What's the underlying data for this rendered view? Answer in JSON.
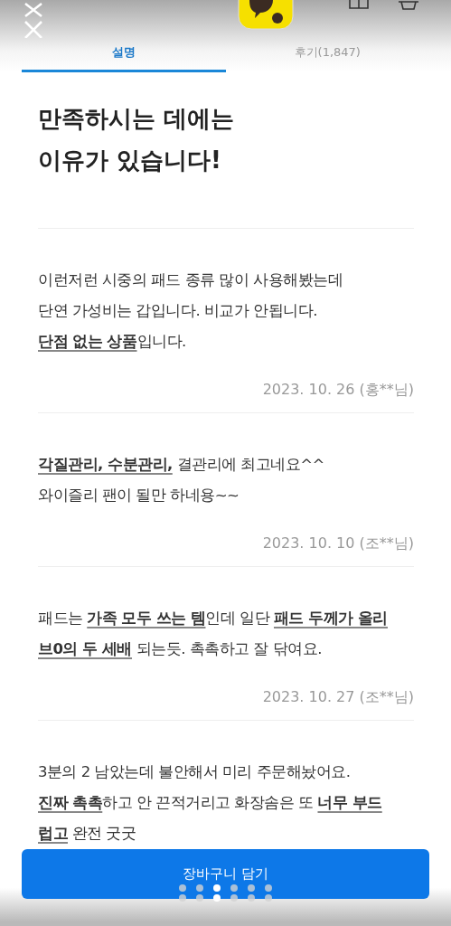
{
  "tabs": [
    {
      "label": "설명",
      "selected": true
    },
    {
      "label": "후기(1,847)",
      "selected": false
    }
  ],
  "heading": "만족하시는 데에는\n이유가 있습니다!",
  "reviews": [
    {
      "text": "이런저런 시중의 패드 종류 많이 사용해봤는데\n단연 가성비는 갑입니다. 비교가 안됩니다.\n**단점 없는 상품**입니다.",
      "date": "2023. 10. 26 (홍**님)"
    },
    {
      "text": "**각질관리, 수분관리,** 결관리에 최고네요^^\n와이즐리 팬이 될만 하네용~~",
      "date": "2023. 10. 10 (조**님)"
    },
    {
      "text": "패드는 **가족 모두 쓰는 템**인데 일단 **패드 두께가 올리\n브0의 두 세배** 되는듯. 촉촉하고 잘 닦여요.",
      "date": "2023. 10. 27 (조**님)"
    },
    {
      "text": "3분의 2 남았는데 불안해서 미리 주문해놨어요.\n**진짜 촉촉**하고 안 끈적거리고 화장솜은 또 **너무 부드\n럽고** 완전 굿굿"
    }
  ],
  "cart_button": "장바구니 담기",
  "page_dots": [
    [
      {
        "selected": false
      },
      {
        "selected": false
      },
      {
        "selected": true
      },
      {
        "selected": false
      },
      {
        "selected": false
      },
      {
        "selected": false
      }
    ],
    [
      {
        "selected": false
      },
      {
        "selected": false
      },
      {
        "selected": true
      },
      {
        "selected": false
      },
      {
        "selected": false
      },
      {
        "selected": false
      }
    ]
  ]
}
